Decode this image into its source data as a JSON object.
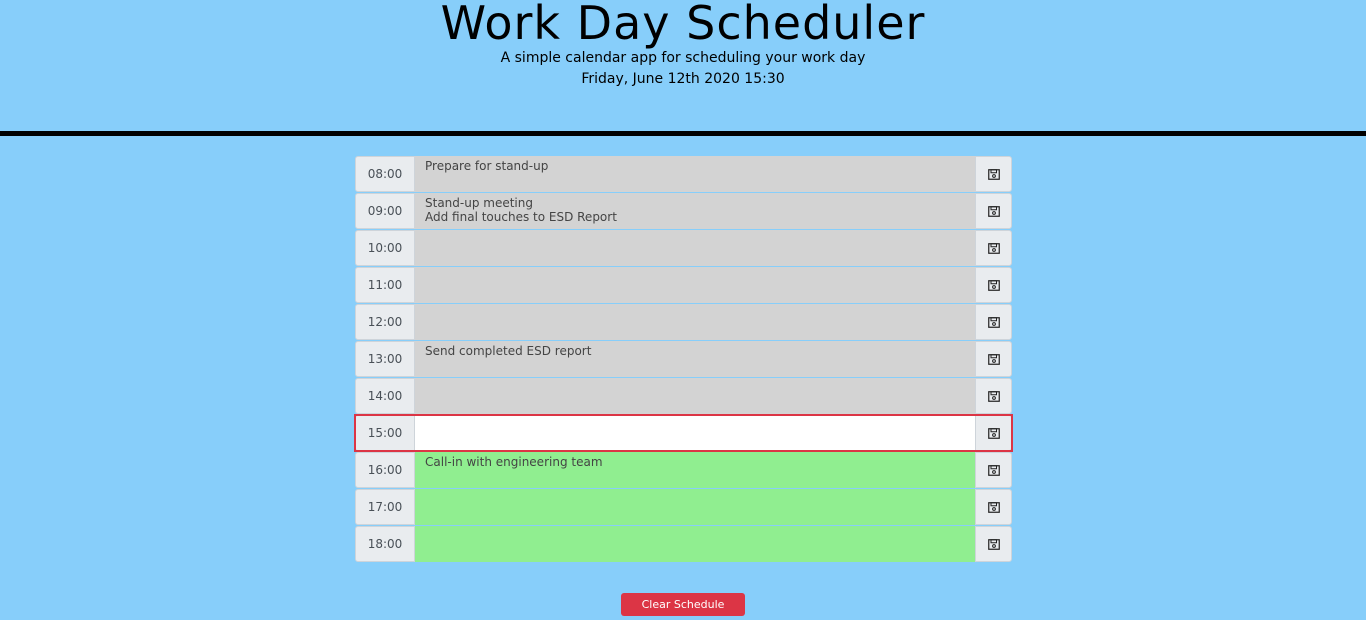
{
  "header": {
    "title": "Work Day Scheduler",
    "subtitle": "A simple calendar app for scheduling your work day",
    "current_datetime": "Friday, June 12th 2020 15:30"
  },
  "schedule": [
    {
      "hour": "08:00",
      "text": "Prepare for stand-up",
      "state": "past"
    },
    {
      "hour": "09:00",
      "text": "Stand-up meeting\nAdd final touches to ESD Report",
      "state": "past"
    },
    {
      "hour": "10:00",
      "text": "",
      "state": "past"
    },
    {
      "hour": "11:00",
      "text": "",
      "state": "past"
    },
    {
      "hour": "12:00",
      "text": "",
      "state": "past"
    },
    {
      "hour": "13:00",
      "text": "Send completed ESD report",
      "state": "past"
    },
    {
      "hour": "14:00",
      "text": "",
      "state": "past"
    },
    {
      "hour": "15:00",
      "text": "",
      "state": "present"
    },
    {
      "hour": "16:00",
      "text": "Call-in with engineering team",
      "state": "future"
    },
    {
      "hour": "17:00",
      "text": "",
      "state": "future"
    },
    {
      "hour": "18:00",
      "text": "",
      "state": "future"
    }
  ],
  "icons": {
    "save": "floppy-disk-icon"
  },
  "colors": {
    "page_background": "#87cefa",
    "past": "#d3d3d3",
    "present": "#ffffff",
    "future": "#90ee90",
    "current_outline": "#dc3545",
    "clear_button": "#dc3545"
  },
  "actions": {
    "clear_label": "Clear Schedule"
  }
}
